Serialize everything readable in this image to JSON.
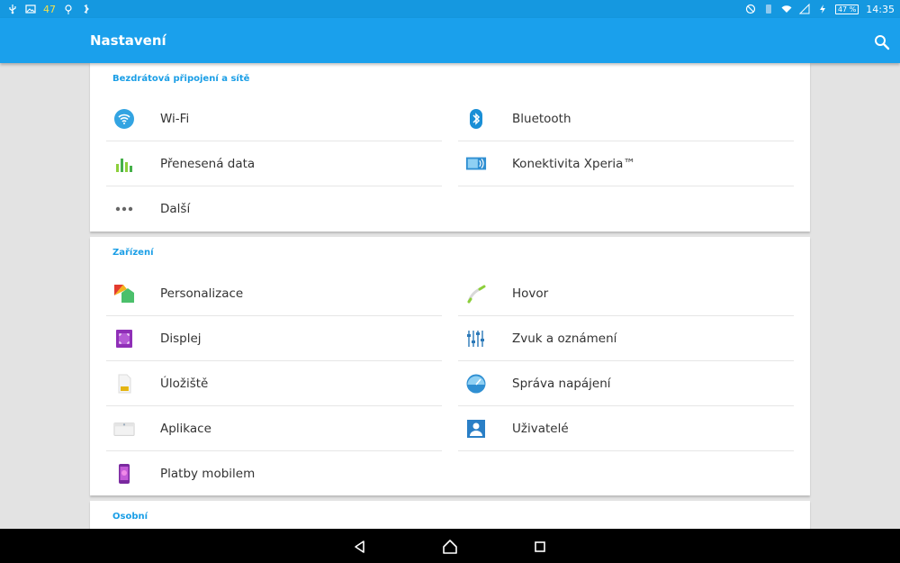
{
  "status_bar": {
    "notification_count": "47",
    "battery": "47 %",
    "time": "14:35"
  },
  "app_bar": {
    "title": "Nastavení"
  },
  "sections": {
    "wireless": {
      "title": "Bezdrátová připojení a sítě",
      "items": [
        {
          "label": "Wi-Fi",
          "icon": "wifi-icon"
        },
        {
          "label": "Bluetooth",
          "icon": "bluetooth-icon"
        },
        {
          "label": "Přenesená data",
          "icon": "data-usage-icon"
        },
        {
          "label": "Konektivita Xperia™",
          "icon": "xperia-connectivity-icon"
        },
        {
          "label": "Další",
          "icon": "more-dots-icon"
        }
      ]
    },
    "device": {
      "title": "Zařízení",
      "items": [
        {
          "label": "Personalizace",
          "icon": "personalization-icon"
        },
        {
          "label": "Hovor",
          "icon": "call-icon"
        },
        {
          "label": "Displej",
          "icon": "display-icon"
        },
        {
          "label": "Zvuk a oznámení",
          "icon": "sound-sliders-icon"
        },
        {
          "label": "Úložiště",
          "icon": "storage-sd-icon"
        },
        {
          "label": "Správa napájení",
          "icon": "power-management-icon"
        },
        {
          "label": "Aplikace",
          "icon": "apps-icon"
        },
        {
          "label": "Uživatelé",
          "icon": "users-icon"
        },
        {
          "label": "Platby mobilem",
          "icon": "mobile-payment-icon"
        }
      ]
    },
    "personal": {
      "title": "Osobní"
    }
  },
  "colors": {
    "status_bar": "#1598e0",
    "app_bar": "#1aa0ec",
    "section_header": "#1a9ee6",
    "background": "#e3e3e3"
  }
}
